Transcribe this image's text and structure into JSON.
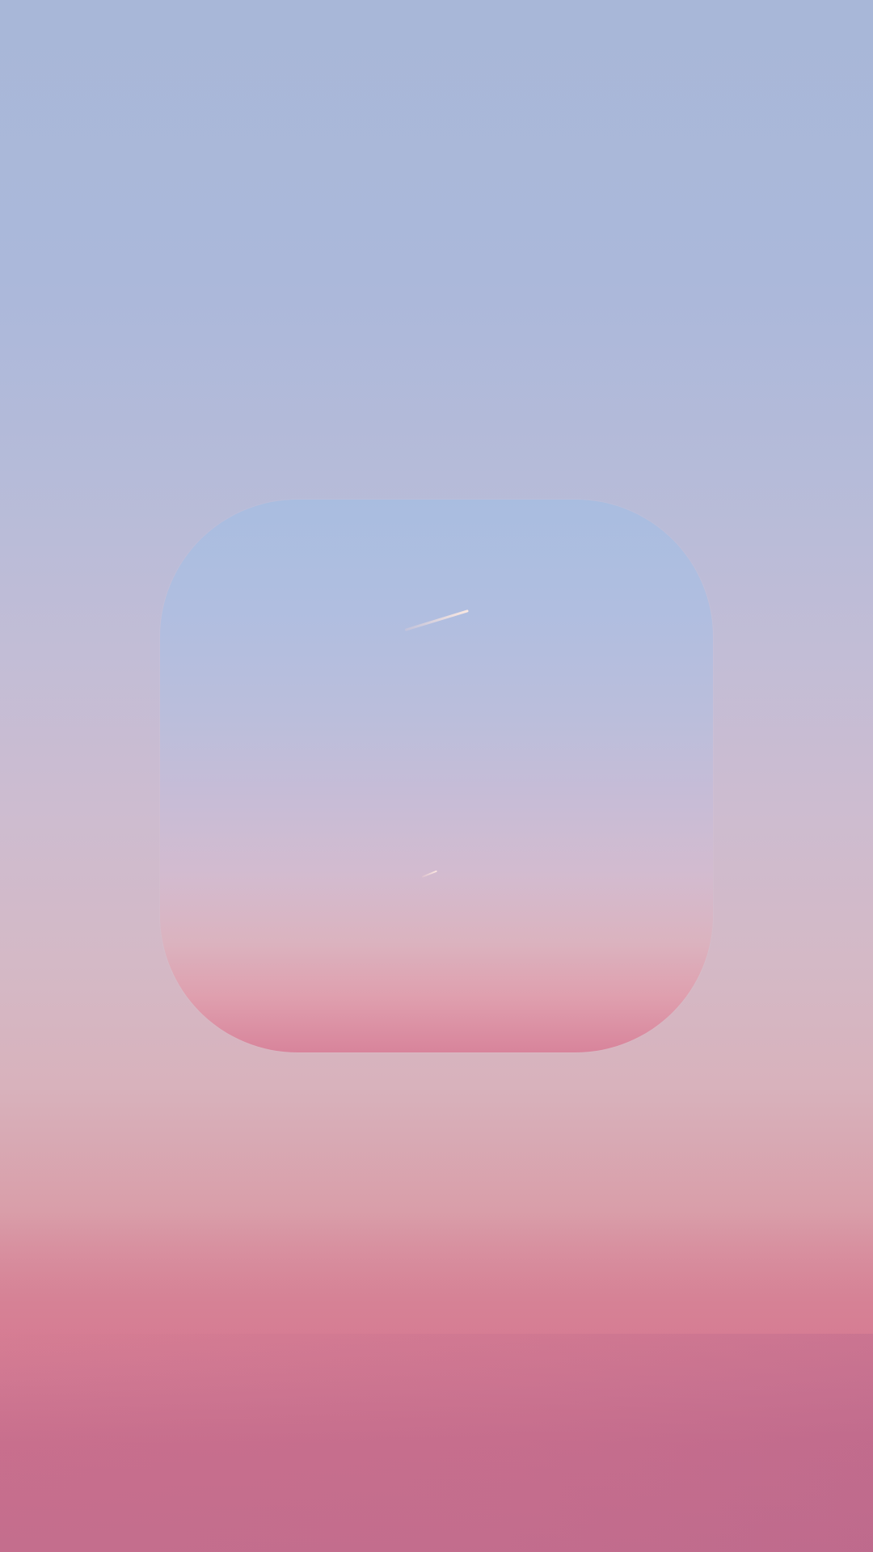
{
  "colors": {
    "sky_top": "#a8b7d8",
    "sky_middle": "#cdbcd0",
    "sky_bottom": "#c46e8d",
    "window_top": "#a9bde0",
    "window_bottom": "#d8849b",
    "contrail": "#ffe5dc"
  },
  "icons": {
    "window": "rounded-square-window",
    "long_contrail": "contrail-icon",
    "short_contrail": "contrail-icon"
  }
}
